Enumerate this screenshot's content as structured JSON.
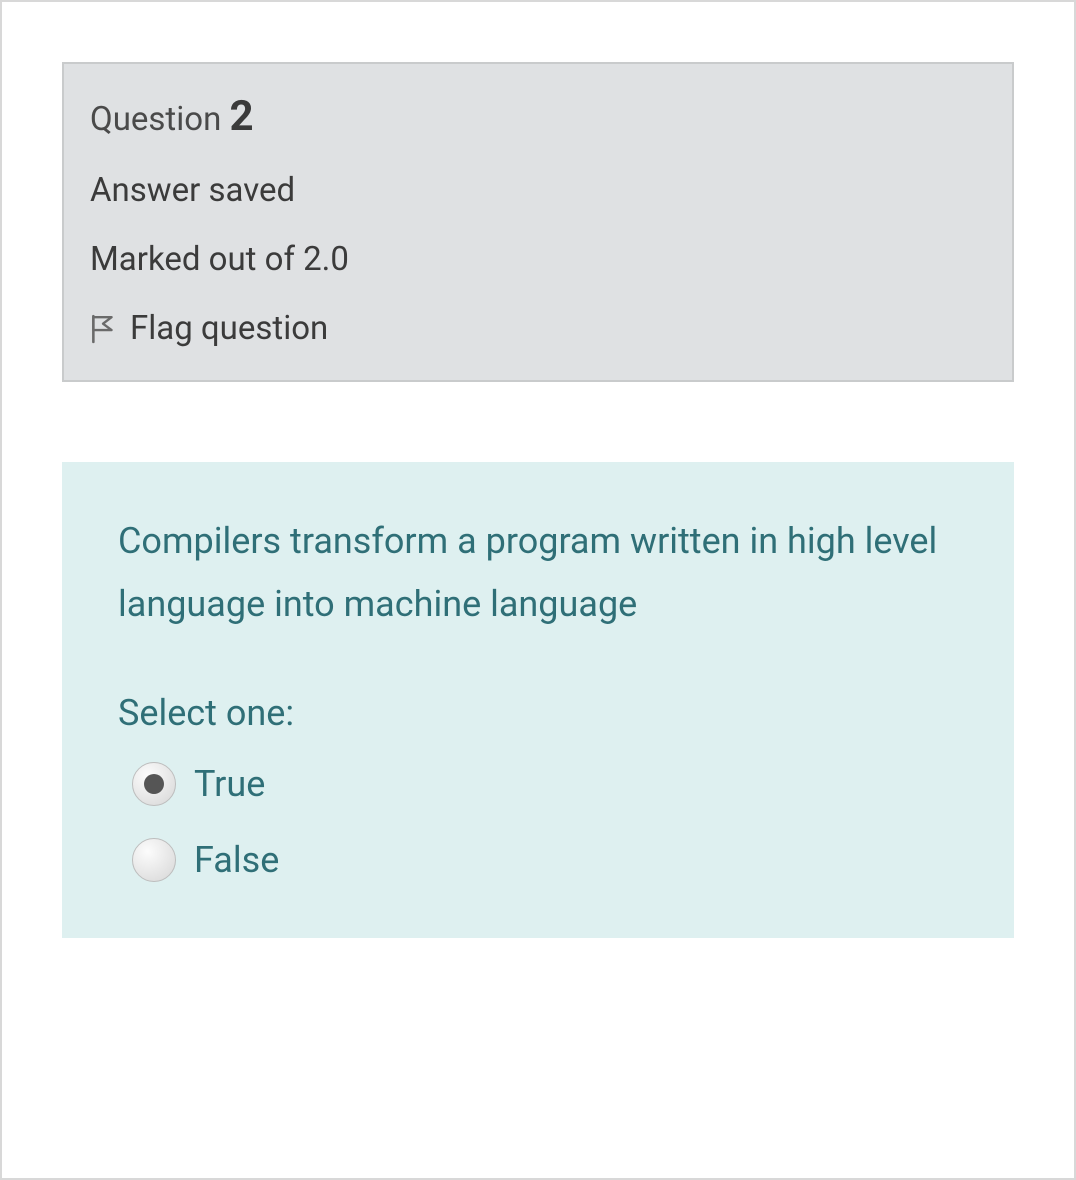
{
  "header": {
    "question_word": "Question",
    "question_number": "2",
    "answer_status": "Answer saved",
    "marked_out": "Marked out of 2.0",
    "flag_label": "Flag question"
  },
  "body": {
    "question_text": "Compilers transform a program written in high level language into machine language",
    "select_label": "Select one:",
    "options": [
      {
        "label": "True",
        "selected": true
      },
      {
        "label": "False",
        "selected": false
      }
    ]
  }
}
